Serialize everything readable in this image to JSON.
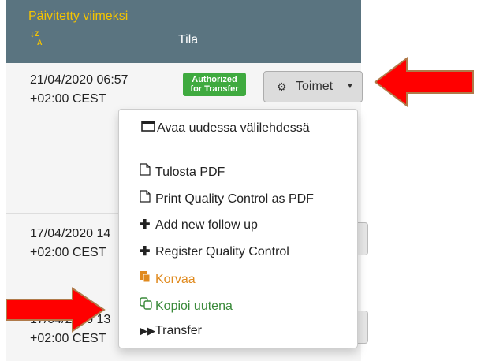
{
  "table": {
    "header": {
      "col_updated": "Päivitetty viimeksi",
      "sort_icon": "sort-alpha-desc-icon",
      "sort_glyph": "↓ᶻₐ",
      "col_status": "Tila"
    },
    "rows": [
      {
        "date": "21/04/2020 06:57",
        "tz": "+02:00 CEST",
        "status_badge": "Authorized for Transfer"
      },
      {
        "date": "17/04/2020 14",
        "tz": "+02:00 CEST"
      },
      {
        "date": "17/04/2020 13",
        "tz": "+02:00 CEST"
      }
    ],
    "actions_button": "Toimet"
  },
  "dropdown": {
    "items": [
      {
        "label": "Avaa uudessa välilehdessä",
        "icon": "window-icon"
      },
      {
        "label": "Tulosta PDF",
        "icon": "pdf-file-icon"
      },
      {
        "label": "Print Quality Control as PDF",
        "icon": "pdf-file-icon"
      },
      {
        "label": "Add new follow up",
        "icon": "plus-icon"
      },
      {
        "label": "Register Quality Control",
        "icon": "plus-icon"
      },
      {
        "label": "Korvaa",
        "icon": "replace-icon",
        "color": "#e08a1e"
      },
      {
        "label": "Kopioi uutena",
        "icon": "copy-icon",
        "color": "#3a8a3a"
      },
      {
        "label": "Transfer",
        "icon": "fast-forward-icon"
      }
    ]
  },
  "colors": {
    "header_bg": "#5a7480",
    "header_accent": "#f5c400",
    "badge_green": "#3faa3f",
    "arrow_red": "#ff0000"
  }
}
